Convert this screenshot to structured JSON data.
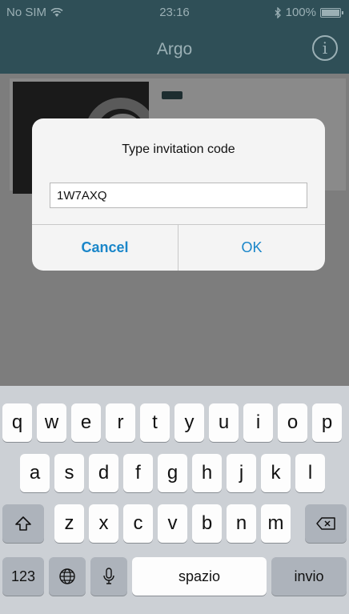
{
  "status_bar": {
    "carrier": "No SIM",
    "time": "23:16",
    "battery": "100%"
  },
  "nav": {
    "title": "Argo",
    "info_icon": "i"
  },
  "alert": {
    "title": "Type invitation code",
    "input_value": "1W7AXQ",
    "cancel_label": "Cancel",
    "ok_label": "OK"
  },
  "keyboard": {
    "row1": [
      "q",
      "w",
      "e",
      "r",
      "t",
      "y",
      "u",
      "i",
      "o",
      "p"
    ],
    "row2": [
      "a",
      "s",
      "d",
      "f",
      "g",
      "h",
      "j",
      "k",
      "l"
    ],
    "row3": [
      "z",
      "x",
      "c",
      "v",
      "b",
      "n",
      "m"
    ],
    "numbers_label": "123",
    "space_label": "spazio",
    "return_label": "invio"
  },
  "colors": {
    "nav_bg": "#2f4f57",
    "accent": "#1a86c9",
    "keyboard_bg": "#ccd0d5"
  }
}
